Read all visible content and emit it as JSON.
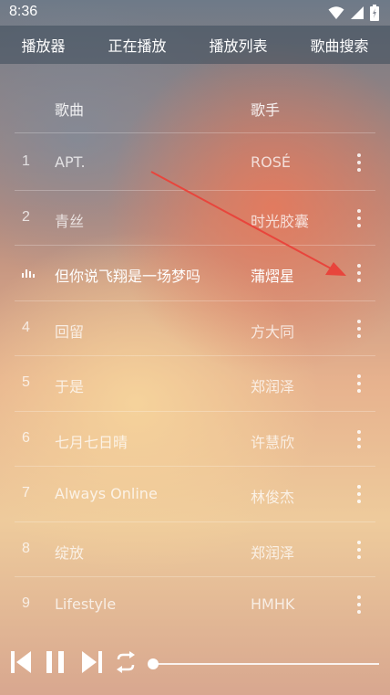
{
  "status_bar": {
    "time": "8:36"
  },
  "tabs": [
    {
      "label": "播放器"
    },
    {
      "label": "正在播放"
    },
    {
      "label": "播放列表"
    },
    {
      "label": "歌曲搜索"
    }
  ],
  "header": {
    "song": "歌曲",
    "artist": "歌手"
  },
  "songs": [
    {
      "num": "1",
      "title": "APT.",
      "artist": "ROSÉ"
    },
    {
      "num": "2",
      "title": "青丝",
      "artist": "时光胶囊"
    },
    {
      "num": "",
      "title": "但你说飞翔是一场梦吗",
      "artist": "蒲熠星"
    },
    {
      "num": "4",
      "title": "回留",
      "artist": "方大同"
    },
    {
      "num": "5",
      "title": "于是",
      "artist": "郑润泽"
    },
    {
      "num": "6",
      "title": "七月七日晴",
      "artist": "许慧欣"
    },
    {
      "num": "7",
      "title": "Always Online",
      "artist": "林俊杰"
    },
    {
      "num": "8",
      "title": "绽放",
      "artist": "郑润泽"
    },
    {
      "num": "9",
      "title": "Lifestyle",
      "artist": "HMHK"
    }
  ],
  "player": {
    "progress": 0
  },
  "colors": {
    "arrow": "#e8453c",
    "tab_bar": "#3c4b5a"
  },
  "icons": [
    "wifi-icon",
    "signal-icon",
    "battery-icon",
    "equalizer-icon",
    "more-vert-icon",
    "previous-icon",
    "pause-icon",
    "next-icon",
    "repeat-icon"
  ]
}
